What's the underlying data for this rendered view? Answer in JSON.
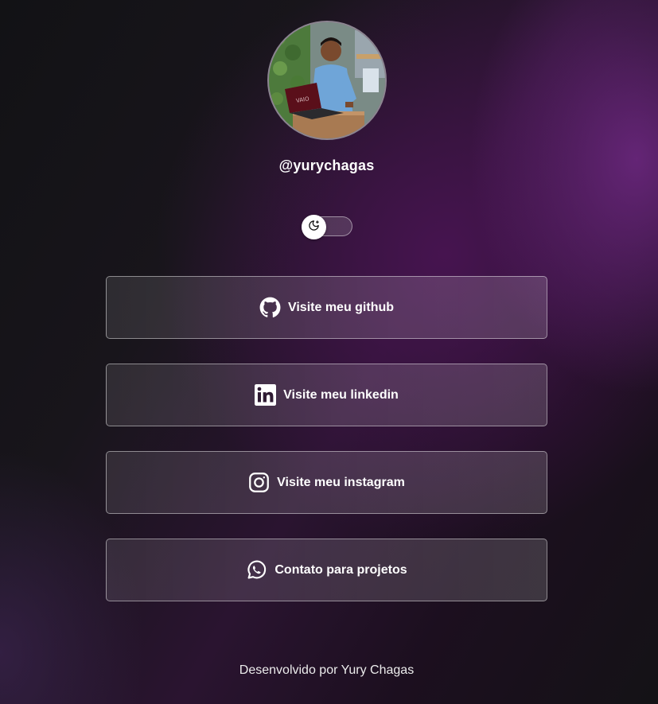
{
  "profile": {
    "username": "@yurychagas",
    "avatar": "profile-photo"
  },
  "theme_toggle": {
    "icon": "moon-stars-icon",
    "state": "dark"
  },
  "links": [
    {
      "label": "Visite meu github",
      "icon": "github-icon"
    },
    {
      "label": "Visite meu linkedin",
      "icon": "linkedin-icon"
    },
    {
      "label": "Visite meu instagram",
      "icon": "instagram-icon"
    },
    {
      "label": "Contato para projetos",
      "icon": "whatsapp-icon"
    }
  ],
  "footer": {
    "text": "Desenvolvido por Yury Chagas"
  },
  "colors": {
    "background_dark": "#121215",
    "background_accent": "#5a1f6a",
    "text": "#ffffff",
    "button_border": "#8f8794"
  }
}
